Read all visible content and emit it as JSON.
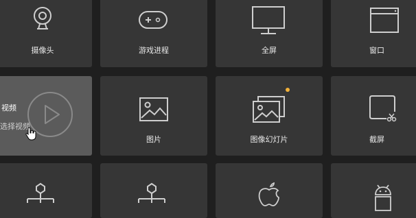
{
  "tiles_row1": [
    {
      "label": "摄像头",
      "icon": "webcam-icon"
    },
    {
      "label": "游戏进程",
      "icon": "gamepad-icon"
    },
    {
      "label": "全屏",
      "icon": "monitor-icon"
    },
    {
      "label": "窗口",
      "icon": "window-icon"
    }
  ],
  "tiles_row2": [
    {
      "label": "视频",
      "sublabel": "选择视频",
      "icon": "play-icon",
      "state": "hover"
    },
    {
      "label": "图片",
      "icon": "image-icon"
    },
    {
      "label": "图像幻灯片",
      "icon": "slideshow-icon",
      "badge": "new-dot"
    },
    {
      "label": "截屏",
      "icon": "screenshot-crop-icon"
    }
  ],
  "tiles_row3": [
    {
      "label": "",
      "icon": "hierarchy-icon"
    },
    {
      "label": "",
      "icon": "hierarchy-icon"
    },
    {
      "label": "",
      "icon": "apple-icon"
    },
    {
      "label": "",
      "icon": "android-icon"
    }
  ],
  "colors": {
    "background": "#1f1f1f",
    "tile": "#363636",
    "tile_hover": "#5b5b5b",
    "accent_dot": "#f2b13a"
  }
}
